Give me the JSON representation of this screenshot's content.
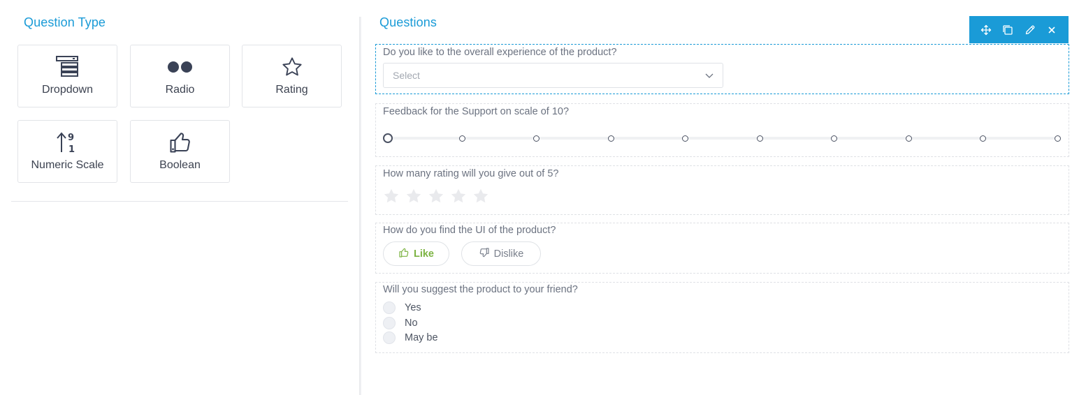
{
  "left": {
    "title": "Question Type",
    "types": [
      {
        "label": "Dropdown",
        "icon": "dropdown-icon"
      },
      {
        "label": "Radio",
        "icon": "radio-icon"
      },
      {
        "label": "Rating",
        "icon": "star-outline-icon"
      },
      {
        "label": "Numeric Scale",
        "icon": "numeric-scale-icon"
      },
      {
        "label": "Boolean",
        "icon": "thumbs-up-icon"
      }
    ]
  },
  "right": {
    "title": "Questions",
    "toolbar": [
      "move-icon",
      "duplicate-icon",
      "edit-icon",
      "close-icon"
    ],
    "questions": {
      "q1": {
        "label": "Do you like to the overall experience of the product?",
        "placeholder": "Select"
      },
      "q2": {
        "label": "Feedback for the Support on scale of 10?",
        "scale_points": 10,
        "selected": 1
      },
      "q3": {
        "label": "How many rating will you give out of 5?",
        "max_stars": 5,
        "rating": 0
      },
      "q4": {
        "label": "How do you find the UI of the product?",
        "like_label": "Like",
        "dislike_label": "Dislike"
      },
      "q5": {
        "label": "Will you suggest the product to your friend?",
        "options": [
          "Yes",
          "No",
          "May be"
        ]
      }
    }
  },
  "colors": {
    "accent": "#1a9bd7",
    "like": "#7cb342",
    "icon_dark": "#3a4256",
    "star_empty": "#e9eaed"
  }
}
